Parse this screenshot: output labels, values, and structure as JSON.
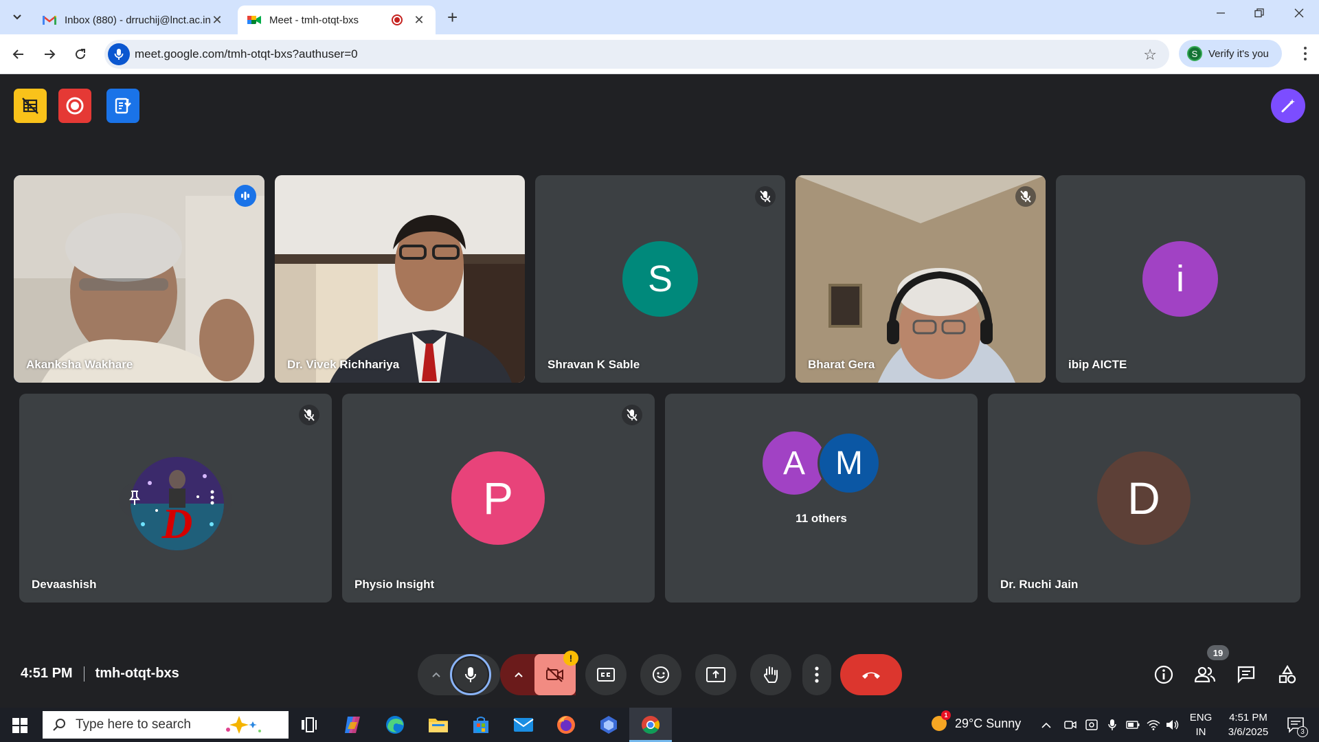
{
  "browser": {
    "tabs": [
      {
        "title": "Inbox (880) - drruchij@lnct.ac.in",
        "icon": "gmail-icon",
        "active": false
      },
      {
        "title": "Meet - tmh-otqt-bxs",
        "icon": "meet-icon",
        "active": true
      }
    ],
    "url": "meet.google.com/tmh-otqt-bxs?authuser=0",
    "verify_label": "Verify it's you",
    "profile_initial": "S"
  },
  "participants": [
    {
      "name": "Akanksha Wakhare",
      "type": "video",
      "speaking": true
    },
    {
      "name": "Dr. Vivek Richhariya",
      "type": "video",
      "muted": false
    },
    {
      "name": "Shravan K Sable",
      "type": "avatar",
      "initial": "S",
      "color": "#00897b",
      "muted": true
    },
    {
      "name": "Bharat Gera",
      "type": "video",
      "muted": true
    },
    {
      "name": "ibip AICTE",
      "type": "avatar",
      "initial": "i",
      "color": "#a142c4",
      "muted": false
    },
    {
      "name": "Devaashish",
      "type": "profile-photo",
      "muted": true
    },
    {
      "name": "Physio Insight",
      "type": "avatar",
      "initial": "P",
      "color": "#e8437a",
      "muted": true
    },
    {
      "name": "11 others",
      "type": "group",
      "initials": [
        "A",
        "M"
      ],
      "colors": [
        "#a142c4",
        "#0b57a4"
      ]
    },
    {
      "name": "Dr. Ruchi Jain",
      "type": "avatar",
      "initial": "D",
      "color": "#5d4037",
      "muted": false
    }
  ],
  "meeting": {
    "time": "4:51 PM",
    "code": "tmh-otqt-bxs",
    "people_count": "19",
    "camera_warning": "!"
  },
  "taskbar": {
    "search_placeholder": "Type here to search",
    "weather": "29°C  Sunny",
    "weather_badge": "1",
    "lang_top": "ENG",
    "lang_bottom": "IN",
    "clock_time": "4:51 PM",
    "clock_date": "3/6/2025",
    "notif_count": "3"
  }
}
